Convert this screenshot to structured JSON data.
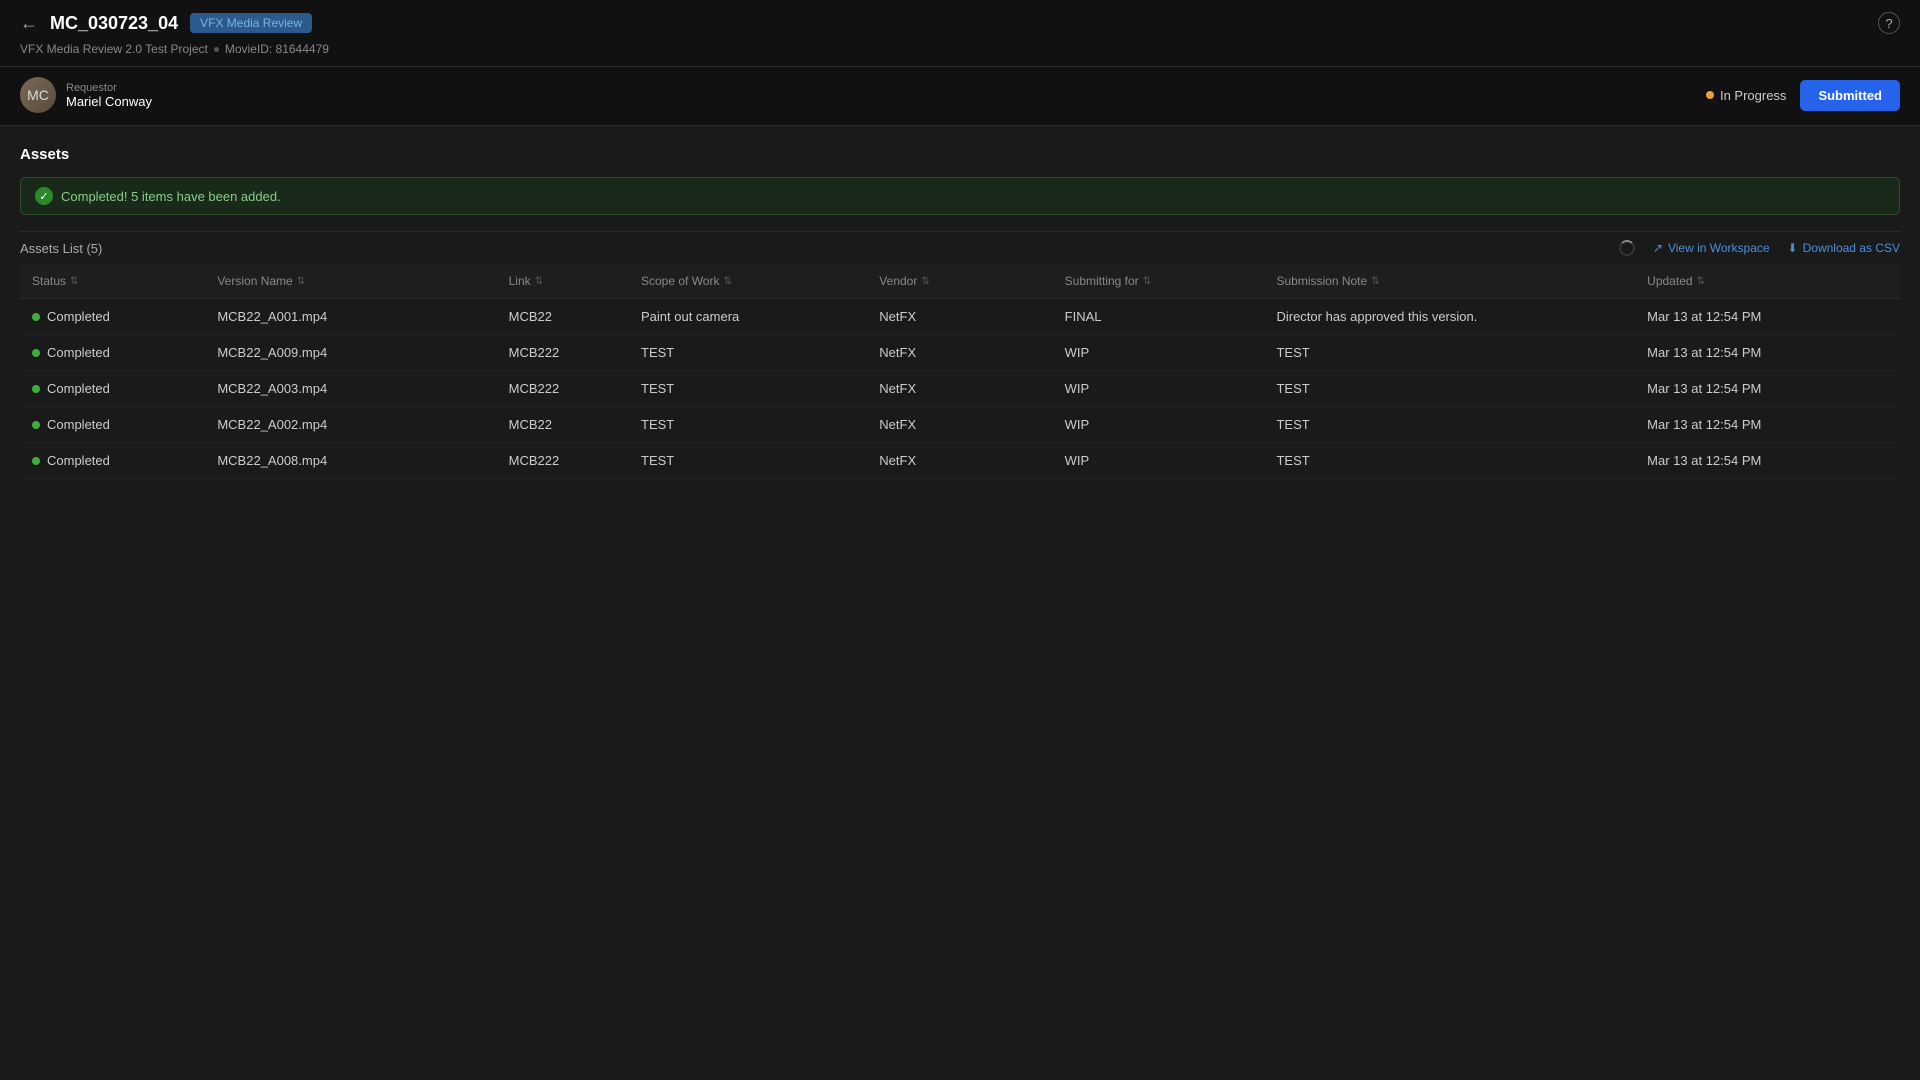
{
  "header": {
    "back_label": "←",
    "title": "MC_030723_04",
    "badge": "VFX Media Review",
    "subtitle_project": "VFX Media Review 2.0 Test Project",
    "subtitle_movie_id": "MovieID: 81644479",
    "help_icon": "?"
  },
  "requestor": {
    "label": "Requestor",
    "name": "Mariel Conway",
    "avatar_initials": "MC"
  },
  "status": {
    "in_progress_label": "In Progress",
    "submitted_label": "Submitted"
  },
  "assets_section": {
    "title": "Assets",
    "success_message": "Completed! 5 items have been added.",
    "list_title": "Assets List (5)",
    "view_workspace_label": "View in Workspace",
    "download_csv_label": "Download as CSV"
  },
  "table": {
    "columns": [
      {
        "key": "status",
        "label": "Status"
      },
      {
        "key": "version_name",
        "label": "Version Name"
      },
      {
        "key": "link",
        "label": "Link"
      },
      {
        "key": "scope_of_work",
        "label": "Scope of Work"
      },
      {
        "key": "vendor",
        "label": "Vendor"
      },
      {
        "key": "submitting_for",
        "label": "Submitting for"
      },
      {
        "key": "submission_note",
        "label": "Submission Note"
      },
      {
        "key": "updated",
        "label": "Updated"
      }
    ],
    "rows": [
      {
        "status": "Completed",
        "version_name": "MCB22_A001.mp4",
        "link": "MCB22",
        "scope_of_work": "Paint out camera",
        "vendor": "NetFX",
        "submitting_for": "FINAL",
        "submission_note": "Director has approved this version.",
        "updated": "Mar 13 at 12:54 PM"
      },
      {
        "status": "Completed",
        "version_name": "MCB22_A009.mp4",
        "link": "MCB222",
        "scope_of_work": "TEST",
        "vendor": "NetFX",
        "submitting_for": "WIP",
        "submission_note": "TEST",
        "updated": "Mar 13 at 12:54 PM"
      },
      {
        "status": "Completed",
        "version_name": "MCB22_A003.mp4",
        "link": "MCB222",
        "scope_of_work": "TEST",
        "vendor": "NetFX",
        "submitting_for": "WIP",
        "submission_note": "TEST",
        "updated": "Mar 13 at 12:54 PM"
      },
      {
        "status": "Completed",
        "version_name": "MCB22_A002.mp4",
        "link": "MCB22",
        "scope_of_work": "TEST",
        "vendor": "NetFX",
        "submitting_for": "WIP",
        "submission_note": "TEST",
        "updated": "Mar 13 at 12:54 PM"
      },
      {
        "status": "Completed",
        "version_name": "MCB22_A008.mp4",
        "link": "MCB222",
        "scope_of_work": "TEST",
        "vendor": "NetFX",
        "submitting_for": "WIP",
        "submission_note": "TEST",
        "updated": "Mar 13 at 12:54 PM"
      }
    ]
  }
}
